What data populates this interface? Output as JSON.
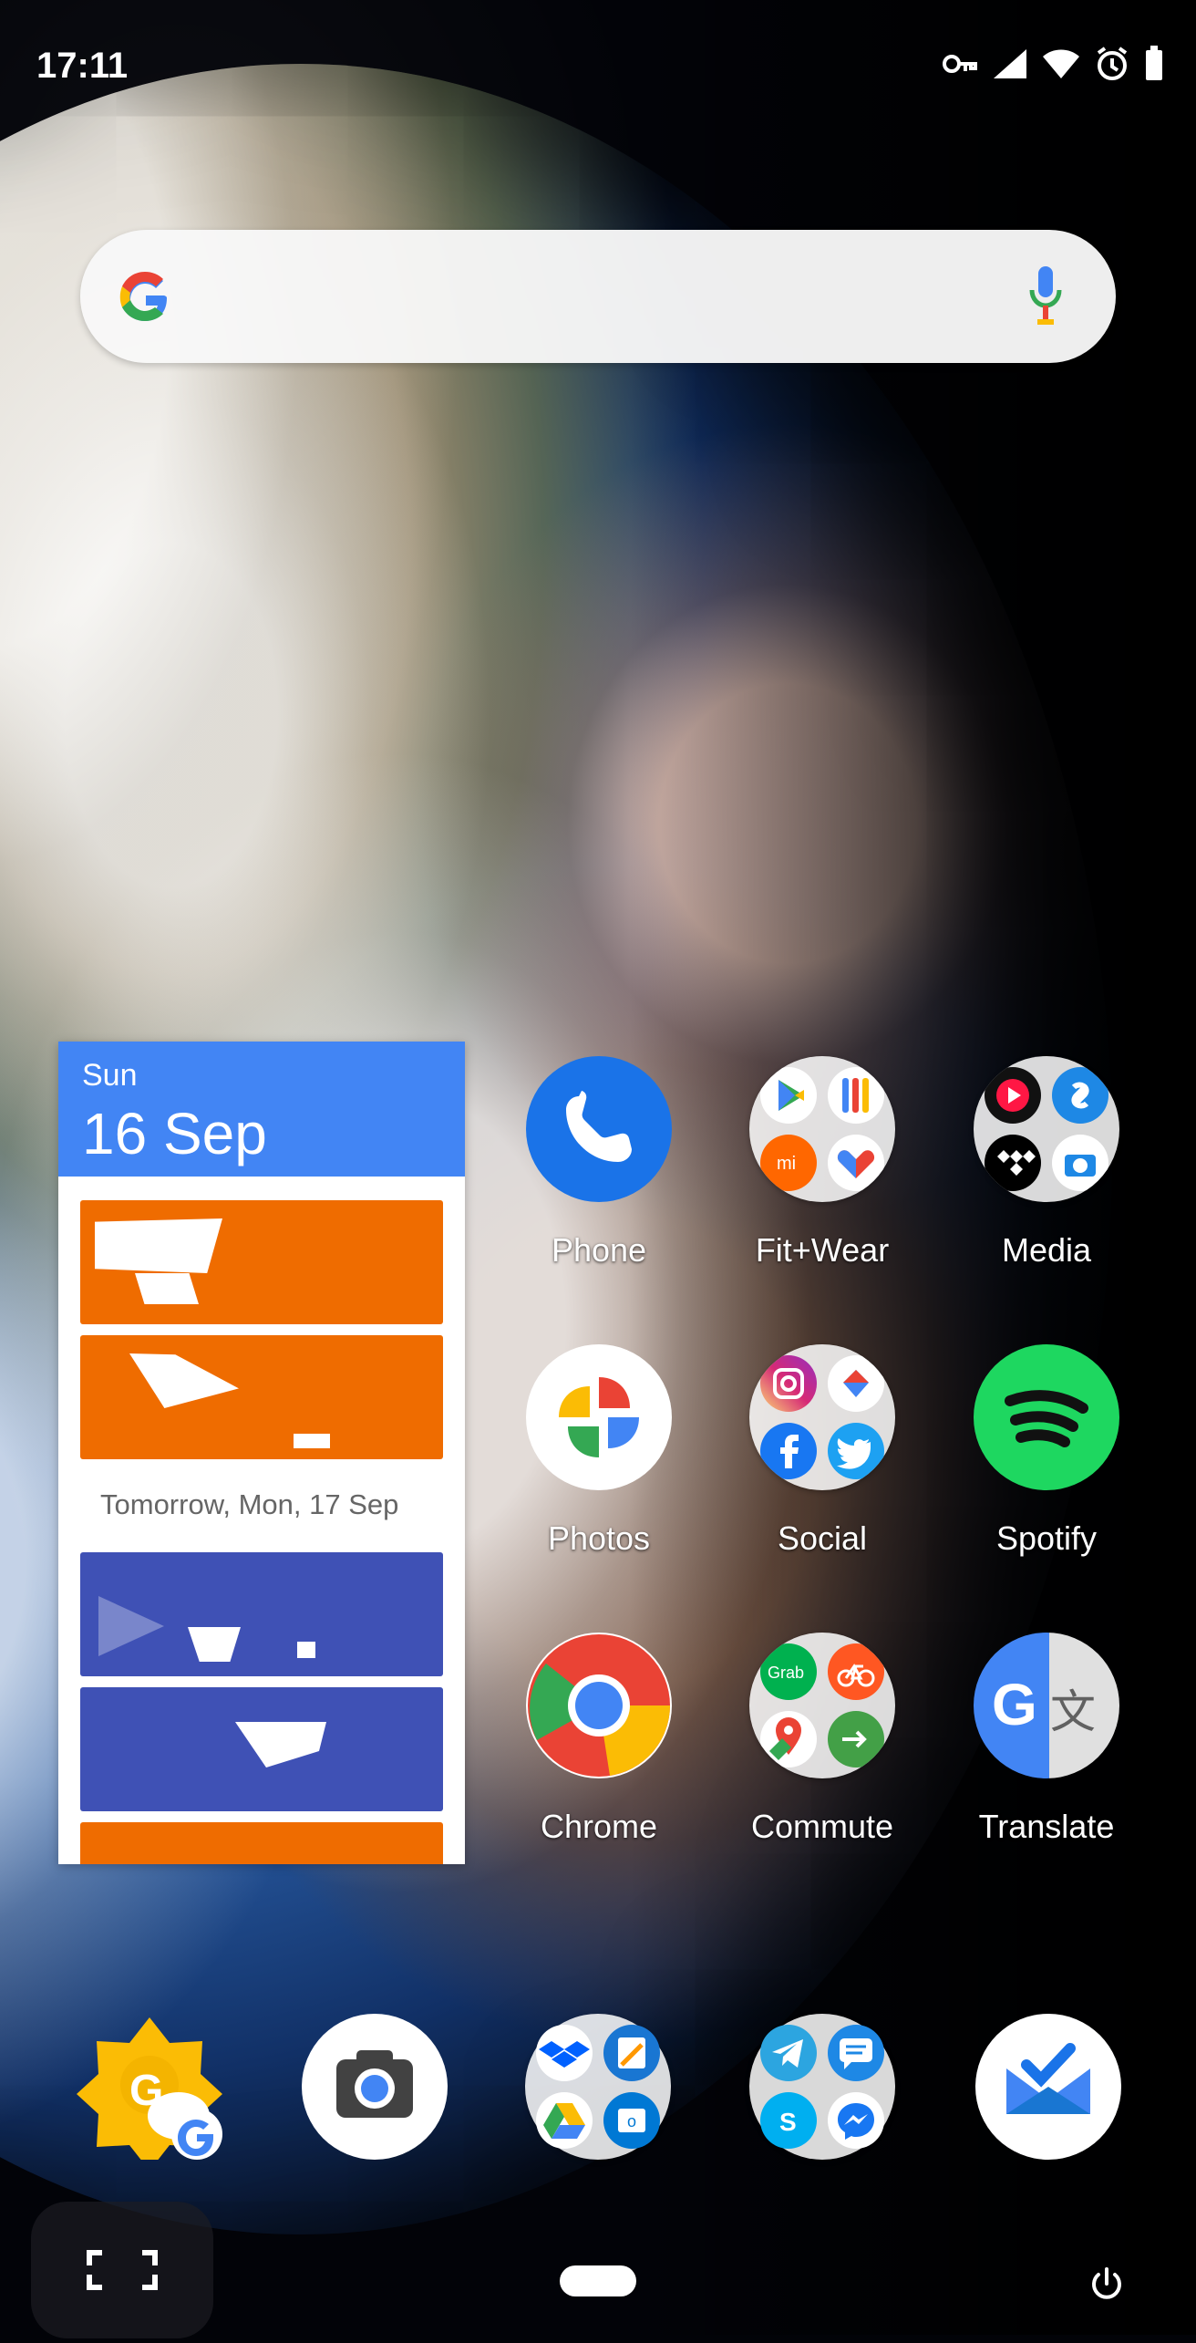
{
  "status_bar": {
    "time": "17:11",
    "icons": [
      "key-icon",
      "signal-icon",
      "wifi-icon",
      "alarm-icon",
      "battery-icon"
    ]
  },
  "search_bar": {
    "logo": "google-logo",
    "mic_icon": "mic-icon"
  },
  "calendar_widget": {
    "day": "Sun",
    "date": "16 Sep",
    "tomorrow_label": "Tomorrow, Mon, 17 Sep",
    "event_colors": [
      "#ef6c00",
      "#ef6c00",
      "#3f51b5",
      "#3f51b5",
      "#ef6c00"
    ]
  },
  "apps": [
    {
      "label": "Phone",
      "icon": "phone-icon"
    },
    {
      "label": "Fit+Wear",
      "icon": "fitwear-folder-icon"
    },
    {
      "label": "Media",
      "icon": "media-folder-icon"
    },
    {
      "label": "Photos",
      "icon": "photos-icon"
    },
    {
      "label": "Social",
      "icon": "social-folder-icon"
    },
    {
      "label": "Spotify",
      "icon": "spotify-icon"
    },
    {
      "label": "Chrome",
      "icon": "chrome-icon"
    },
    {
      "label": "Commute",
      "icon": "commute-folder-icon"
    },
    {
      "label": "Translate",
      "icon": "translate-icon"
    }
  ],
  "dock": [
    {
      "icon": "google-weather-icon"
    },
    {
      "icon": "camera-icon"
    },
    {
      "icon": "productivity-folder-icon"
    },
    {
      "icon": "messaging-folder-icon"
    },
    {
      "icon": "inbox-icon"
    }
  ],
  "navigation": {
    "left_icon": "fullscreen-icon",
    "home_icon": "home-pill-icon",
    "right_icon": "power-icon"
  },
  "colors": {
    "google_blue": "#4285f4",
    "google_red": "#ea4335",
    "google_yellow": "#fbbc05",
    "google_green": "#34a853",
    "calendar_orange": "#ef6c00",
    "calendar_indigo": "#3f51b5",
    "spotify_green": "#1ed760"
  }
}
